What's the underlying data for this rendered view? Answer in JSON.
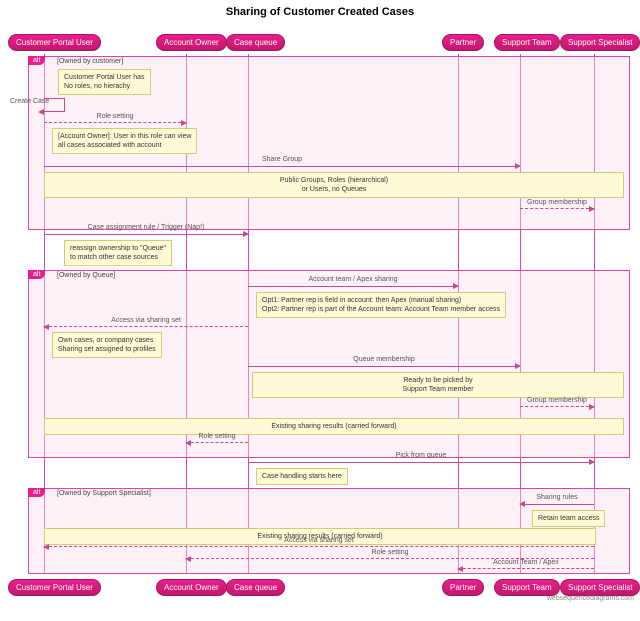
{
  "title": "Sharing of Customer Created Cases",
  "actors": {
    "a0": "Customer Portal User",
    "a1": "Account Owner",
    "a2": "Case queue",
    "a3": "Partner",
    "a4": "Support Team",
    "a5": "Support Specialist"
  },
  "fragments": {
    "f1": "[Owned by customer]",
    "f2": "[Owned by Queue]",
    "f3": "[Owned by Support Specialist]"
  },
  "notes": {
    "n1": "Customer Portal User has\nNo roles, no hierachy",
    "n2": "[Account Owner]: User in this role can view\nall cases associated with account",
    "n3": "Public Groups, Roles (hierarchical)\nor Users, no Queues",
    "n4": "reassign ownership to \"Queue\"\nto match other case sources",
    "n5": "Opt1: Partner rep is field in account: then Apex (manual sharing)\nOpt2: Partner rep is part of the Account team: Account Team member access",
    "n6": "Own cases, or company cases\nSharing set assigned to profiles",
    "n7": "Ready to be picked by\nSupport Team member",
    "n8": "Existing sharing results (carried forward)",
    "n9": "Case handling starts here",
    "n10": "Retain team access",
    "n11": "Existing sharing results (carried forward)"
  },
  "messages": {
    "m_create": "Create Case",
    "m_role": "Role setting",
    "m_share_group": "Share Group",
    "m_group_mem": "Group membership",
    "m_assign": "Case assignment rule / Trigger (Nap!)",
    "m_acct_apex": "Account team / Apex sharing",
    "m_access_set": "Access via sharing set",
    "m_queue_mem": "Queue membership",
    "m_role2": "Role setting",
    "m_pick": "Pick from queue",
    "m_rules": "Sharing rules",
    "m_access_set2": "Access via sharing set",
    "m_role3": "Role setting",
    "m_acct_apex2": "Account Team / Apex"
  },
  "attribution": "websequencediagrams.com"
}
